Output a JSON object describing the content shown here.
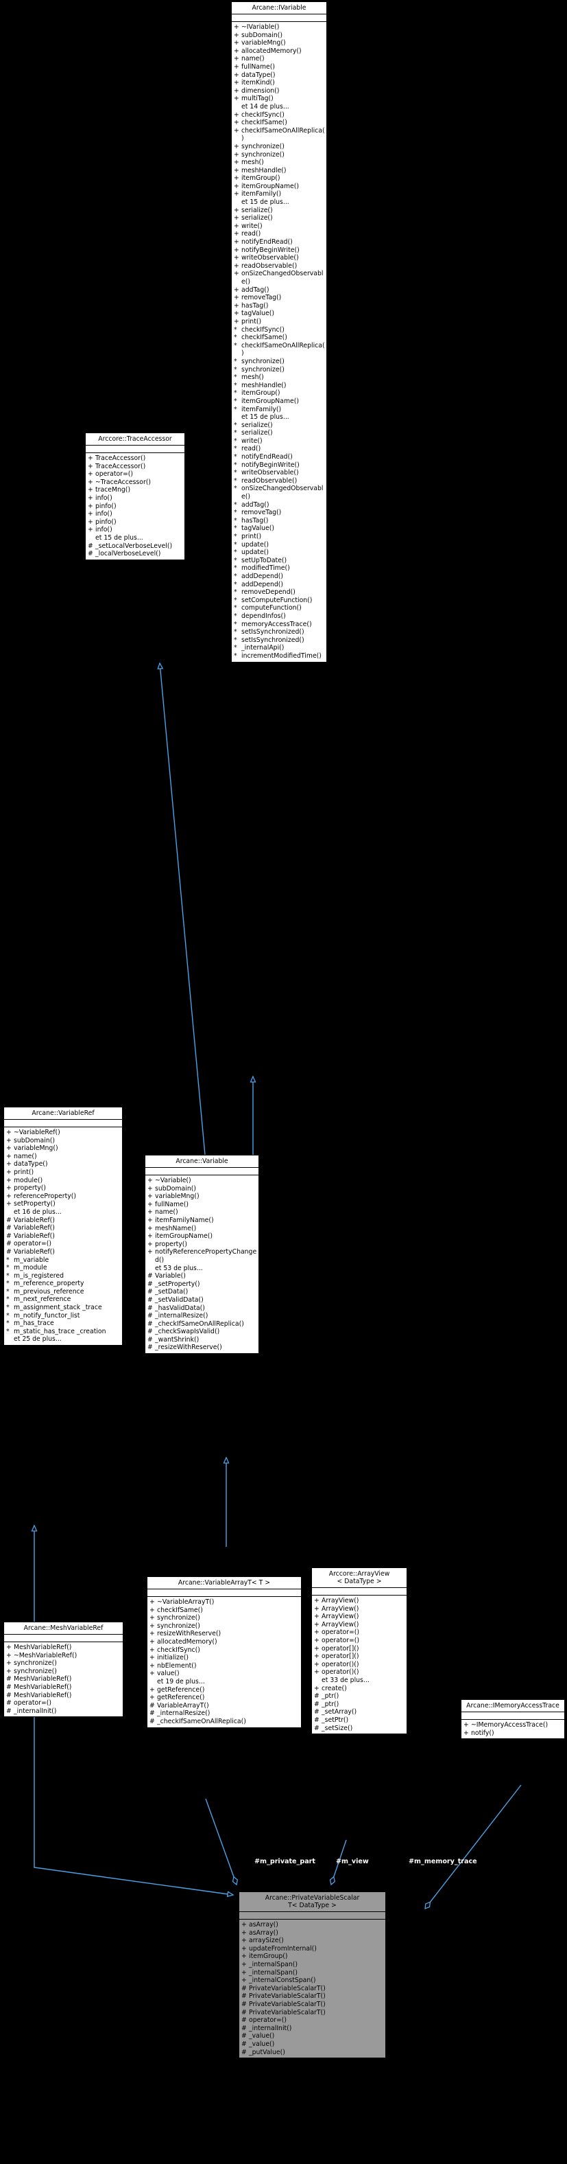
{
  "diagram": {
    "kind": "uml-class-diagram",
    "background": "#000000",
    "edge_color": "#4aa3e8",
    "inherit_arrow_color": "#4aa3e8",
    "node_fill": "#ffffff",
    "node_highlight_fill": "#9a9a9a"
  },
  "nodes": {
    "ivariable": {
      "title": "Arcane::IVariable",
      "members": [
        {
          "vis": "+",
          "name": "~IVariable()"
        },
        {
          "vis": "+",
          "name": "subDomain()"
        },
        {
          "vis": "+",
          "name": "variableMng()"
        },
        {
          "vis": "+",
          "name": "allocatedMemory()"
        },
        {
          "vis": "+",
          "name": "name()"
        },
        {
          "vis": "+",
          "name": "fullName()"
        },
        {
          "vis": "+",
          "name": "dataType()"
        },
        {
          "vis": "+",
          "name": "itemKind()"
        },
        {
          "vis": "+",
          "name": "dimension()"
        },
        {
          "vis": "+",
          "name": "multiTag()"
        },
        {
          "vis": "",
          "name": "et 14 de plus..."
        },
        {
          "vis": "+",
          "name": "checkIfSync()"
        },
        {
          "vis": "+",
          "name": "checkIfSame()"
        },
        {
          "vis": "+",
          "name": "checkIfSameOnAllReplica()"
        },
        {
          "vis": "+",
          "name": "synchronize()"
        },
        {
          "vis": "+",
          "name": "synchronize()"
        },
        {
          "vis": "+",
          "name": "mesh()"
        },
        {
          "vis": "+",
          "name": "meshHandle()"
        },
        {
          "vis": "+",
          "name": "itemGroup()"
        },
        {
          "vis": "+",
          "name": "itemGroupName()"
        },
        {
          "vis": "+",
          "name": "itemFamily()"
        },
        {
          "vis": "",
          "name": "et 15 de plus..."
        },
        {
          "vis": "+",
          "name": "serialize()"
        },
        {
          "vis": "+",
          "name": "serialize()"
        },
        {
          "vis": "+",
          "name": "write()"
        },
        {
          "vis": "+",
          "name": "read()"
        },
        {
          "vis": "+",
          "name": "notifyEndRead()"
        },
        {
          "vis": "+",
          "name": "notifyBeginWrite()"
        },
        {
          "vis": "+",
          "name": "writeObservable()"
        },
        {
          "vis": "+",
          "name": "readObservable()"
        },
        {
          "vis": "+",
          "name": "onSizeChangedObservable()"
        },
        {
          "vis": "+",
          "name": "addTag()"
        },
        {
          "vis": "+",
          "name": "removeTag()"
        },
        {
          "vis": "+",
          "name": "hasTag()"
        },
        {
          "vis": "+",
          "name": "tagValue()"
        },
        {
          "vis": "+",
          "name": "print()"
        },
        {
          "vis": "*",
          "name": "checkIfSync()"
        },
        {
          "vis": "*",
          "name": "checkIfSame()"
        },
        {
          "vis": "*",
          "name": "checkIfSameOnAllReplica()"
        },
        {
          "vis": "*",
          "name": "synchronize()"
        },
        {
          "vis": "*",
          "name": "synchronize()"
        },
        {
          "vis": "*",
          "name": "mesh()"
        },
        {
          "vis": "*",
          "name": "meshHandle()"
        },
        {
          "vis": "*",
          "name": "itemGroup()"
        },
        {
          "vis": "*",
          "name": "itemGroupName()"
        },
        {
          "vis": "*",
          "name": "itemFamily()"
        },
        {
          "vis": "",
          "name": "et 15 de plus..."
        },
        {
          "vis": "*",
          "name": "serialize()"
        },
        {
          "vis": "*",
          "name": "serialize()"
        },
        {
          "vis": "*",
          "name": "write()"
        },
        {
          "vis": "*",
          "name": "read()"
        },
        {
          "vis": "*",
          "name": "notifyEndRead()"
        },
        {
          "vis": "*",
          "name": "notifyBeginWrite()"
        },
        {
          "vis": "*",
          "name": "writeObservable()"
        },
        {
          "vis": "*",
          "name": "readObservable()"
        },
        {
          "vis": "*",
          "name": "onSizeChangedObservable()"
        },
        {
          "vis": "*",
          "name": "addTag()"
        },
        {
          "vis": "*",
          "name": "removeTag()"
        },
        {
          "vis": "*",
          "name": "hasTag()"
        },
        {
          "vis": "*",
          "name": "tagValue()"
        },
        {
          "vis": "*",
          "name": "print()"
        },
        {
          "vis": "*",
          "name": "update()"
        },
        {
          "vis": "*",
          "name": "update()"
        },
        {
          "vis": "*",
          "name": "setUpToDate()"
        },
        {
          "vis": "*",
          "name": "modifiedTime()"
        },
        {
          "vis": "*",
          "name": "addDepend()"
        },
        {
          "vis": "*",
          "name": "addDepend()"
        },
        {
          "vis": "*",
          "name": "removeDepend()"
        },
        {
          "vis": "*",
          "name": "setComputeFunction()"
        },
        {
          "vis": "*",
          "name": "computeFunction()"
        },
        {
          "vis": "*",
          "name": "dependInfos()"
        },
        {
          "vis": "*",
          "name": "memoryAccessTrace()"
        },
        {
          "vis": "*",
          "name": "setIsSynchronized()"
        },
        {
          "vis": "*",
          "name": "setIsSynchronized()"
        },
        {
          "vis": "*",
          "name": "_internalApi()"
        },
        {
          "vis": "*",
          "name": "incrementModifiedTime()"
        }
      ]
    },
    "traceaccessor": {
      "title": "Arccore::TraceAccessor",
      "members": [
        {
          "vis": "+",
          "name": "TraceAccessor()"
        },
        {
          "vis": "+",
          "name": "TraceAccessor()"
        },
        {
          "vis": "+",
          "name": "operator=()"
        },
        {
          "vis": "+",
          "name": "~TraceAccessor()"
        },
        {
          "vis": "+",
          "name": "traceMng()"
        },
        {
          "vis": "+",
          "name": "info()"
        },
        {
          "vis": "+",
          "name": "pinfo()"
        },
        {
          "vis": "+",
          "name": "info()"
        },
        {
          "vis": "+",
          "name": "pinfo()"
        },
        {
          "vis": "+",
          "name": "info()"
        },
        {
          "vis": "",
          "name": "et 15 de plus..."
        },
        {
          "vis": "#",
          "name": "_setLocalVerboseLevel()"
        },
        {
          "vis": "#",
          "name": "_localVerboseLevel()"
        }
      ]
    },
    "variableref": {
      "title": "Arcane::VariableRef",
      "members": [
        {
          "vis": "+",
          "name": "~VariableRef()"
        },
        {
          "vis": "+",
          "name": "subDomain()"
        },
        {
          "vis": "+",
          "name": "variableMng()"
        },
        {
          "vis": "+",
          "name": "name()"
        },
        {
          "vis": "+",
          "name": "dataType()"
        },
        {
          "vis": "+",
          "name": "print()"
        },
        {
          "vis": "+",
          "name": "module()"
        },
        {
          "vis": "+",
          "name": "property()"
        },
        {
          "vis": "+",
          "name": "referenceProperty()"
        },
        {
          "vis": "+",
          "name": "setProperty()"
        },
        {
          "vis": "",
          "name": "et 16 de plus..."
        },
        {
          "vis": "#",
          "name": "VariableRef()"
        },
        {
          "vis": "#",
          "name": "VariableRef()"
        },
        {
          "vis": "#",
          "name": "VariableRef()"
        },
        {
          "vis": "#",
          "name": "operator=()"
        },
        {
          "vis": "#",
          "name": "VariableRef()"
        },
        {
          "vis": "*",
          "name": "m_variable"
        },
        {
          "vis": "*",
          "name": "m_module"
        },
        {
          "vis": "*",
          "name": "m_is_registered"
        },
        {
          "vis": "*",
          "name": "m_reference_property"
        },
        {
          "vis": "*",
          "name": "m_previous_reference"
        },
        {
          "vis": "*",
          "name": "m_next_reference"
        },
        {
          "vis": "*",
          "name": "m_assignment_stack\n_trace"
        },
        {
          "vis": "*",
          "name": "m_notify_functor_list"
        },
        {
          "vis": "*",
          "name": "m_has_trace"
        },
        {
          "vis": "*",
          "name": "m_static_has_trace\n_creation"
        },
        {
          "vis": "",
          "name": "et 25 de plus..."
        }
      ]
    },
    "variable": {
      "title": "Arcane::Variable",
      "members": [
        {
          "vis": "+",
          "name": "~Variable()"
        },
        {
          "vis": "+",
          "name": "subDomain()"
        },
        {
          "vis": "+",
          "name": "variableMng()"
        },
        {
          "vis": "+",
          "name": "fullName()"
        },
        {
          "vis": "+",
          "name": "name()"
        },
        {
          "vis": "+",
          "name": "itemFamilyName()"
        },
        {
          "vis": "+",
          "name": "meshName()"
        },
        {
          "vis": "+",
          "name": "itemGroupName()"
        },
        {
          "vis": "+",
          "name": "property()"
        },
        {
          "vis": "+",
          "name": "notifyReferencePropertyChanged()"
        },
        {
          "vis": "",
          "name": "et 53 de plus..."
        },
        {
          "vis": "#",
          "name": "Variable()"
        },
        {
          "vis": "#",
          "name": "_setProperty()"
        },
        {
          "vis": "#",
          "name": "_setData()"
        },
        {
          "vis": "#",
          "name": "_setValidData()"
        },
        {
          "vis": "#",
          "name": "_hasValidData()"
        },
        {
          "vis": "#",
          "name": "_internalResize()"
        },
        {
          "vis": "#",
          "name": "_checkIfSameOnAllReplica()"
        },
        {
          "vis": "#",
          "name": "_checkSwapIsValid()"
        },
        {
          "vis": "#",
          "name": "_wantShrink()"
        },
        {
          "vis": "#",
          "name": "_resizeWithReserve()"
        }
      ]
    },
    "meshvariableref": {
      "title": "Arcane::MeshVariableRef",
      "members": [
        {
          "vis": "+",
          "name": "MeshVariableRef()"
        },
        {
          "vis": "+",
          "name": "~MeshVariableRef()"
        },
        {
          "vis": "+",
          "name": "synchronize()"
        },
        {
          "vis": "+",
          "name": "synchronize()"
        },
        {
          "vis": "#",
          "name": "MeshVariableRef()"
        },
        {
          "vis": "#",
          "name": "MeshVariableRef()"
        },
        {
          "vis": "#",
          "name": "MeshVariableRef()"
        },
        {
          "vis": "#",
          "name": "operator=()"
        },
        {
          "vis": "#",
          "name": "_internalInit()"
        }
      ]
    },
    "variablearrayt": {
      "title": "Arcane::VariableArrayT< T >",
      "members": [
        {
          "vis": "+",
          "name": "~VariableArrayT()"
        },
        {
          "vis": "+",
          "name": "checkIfSame()"
        },
        {
          "vis": "+",
          "name": "synchronize()"
        },
        {
          "vis": "+",
          "name": "synchronize()"
        },
        {
          "vis": "+",
          "name": "resizeWithReserve()"
        },
        {
          "vis": "+",
          "name": "allocatedMemory()"
        },
        {
          "vis": "+",
          "name": "checkIfSync()"
        },
        {
          "vis": "+",
          "name": "initialize()"
        },
        {
          "vis": "+",
          "name": "nbElement()"
        },
        {
          "vis": "+",
          "name": "value()"
        },
        {
          "vis": "",
          "name": "et 19 de plus..."
        },
        {
          "vis": "+",
          "name": "getReference()"
        },
        {
          "vis": "+",
          "name": "getReference()"
        },
        {
          "vis": "#",
          "name": "VariableArrayT()"
        },
        {
          "vis": "#",
          "name": "_internalResize()"
        },
        {
          "vis": "#",
          "name": "_checkIfSameOnAllReplica()"
        }
      ]
    },
    "arrayview": {
      "title": "Arccore::ArrayView\n< DataType >",
      "members": [
        {
          "vis": "+",
          "name": "ArrayView()"
        },
        {
          "vis": "+",
          "name": "ArrayView()"
        },
        {
          "vis": "+",
          "name": "ArrayView()"
        },
        {
          "vis": "+",
          "name": "ArrayView()"
        },
        {
          "vis": "+",
          "name": "operator=()"
        },
        {
          "vis": "+",
          "name": "operator=()"
        },
        {
          "vis": "+",
          "name": "operator[]()"
        },
        {
          "vis": "+",
          "name": "operator[]()"
        },
        {
          "vis": "+",
          "name": "operator()()"
        },
        {
          "vis": "+",
          "name": "operator()()"
        },
        {
          "vis": "",
          "name": "et 33 de plus..."
        },
        {
          "vis": "+",
          "name": "create()"
        },
        {
          "vis": "#",
          "name": "_ptr()"
        },
        {
          "vis": "#",
          "name": "_ptr()"
        },
        {
          "vis": "#",
          "name": "_setArray()"
        },
        {
          "vis": "#",
          "name": "_setPtr()"
        },
        {
          "vis": "#",
          "name": "_setSize()"
        }
      ]
    },
    "imemoryaccesstrace": {
      "title": "Arcane::IMemoryAccessTrace",
      "members": [
        {
          "vis": "+",
          "name": "~IMemoryAccessTrace()"
        },
        {
          "vis": "+",
          "name": "notify()"
        }
      ]
    },
    "privatevariablescalart": {
      "title": "Arcane::PrivateVariableScalar\nT< DataType >",
      "highlight": true,
      "members": [
        {
          "vis": "+",
          "name": "asArray()"
        },
        {
          "vis": "+",
          "name": "asArray()"
        },
        {
          "vis": "+",
          "name": "arraySize()"
        },
        {
          "vis": "+",
          "name": "updateFromInternal()"
        },
        {
          "vis": "+",
          "name": "itemGroup()"
        },
        {
          "vis": "+",
          "name": "_internalSpan()"
        },
        {
          "vis": "+",
          "name": "_internalSpan()"
        },
        {
          "vis": "+",
          "name": "_internalConstSpan()"
        },
        {
          "vis": "#",
          "name": "PrivateVariableScalarT()"
        },
        {
          "vis": "#",
          "name": "PrivateVariableScalarT()"
        },
        {
          "vis": "#",
          "name": "PrivateVariableScalarT()"
        },
        {
          "vis": "#",
          "name": "PrivateVariableScalarT()"
        },
        {
          "vis": "#",
          "name": "operator=()"
        },
        {
          "vis": "#",
          "name": "_internalInit()"
        },
        {
          "vis": "#",
          "name": "_value()"
        },
        {
          "vis": "#",
          "name": "_value()"
        },
        {
          "vis": "#",
          "name": "_putValue()"
        }
      ]
    }
  },
  "edge_labels": [
    {
      "id": "m_private_part",
      "text": "#m_private_part"
    },
    {
      "id": "m_view",
      "text": "#m_view"
    },
    {
      "id": "m_memory_trace",
      "text": "#m_memory_trace"
    }
  ]
}
